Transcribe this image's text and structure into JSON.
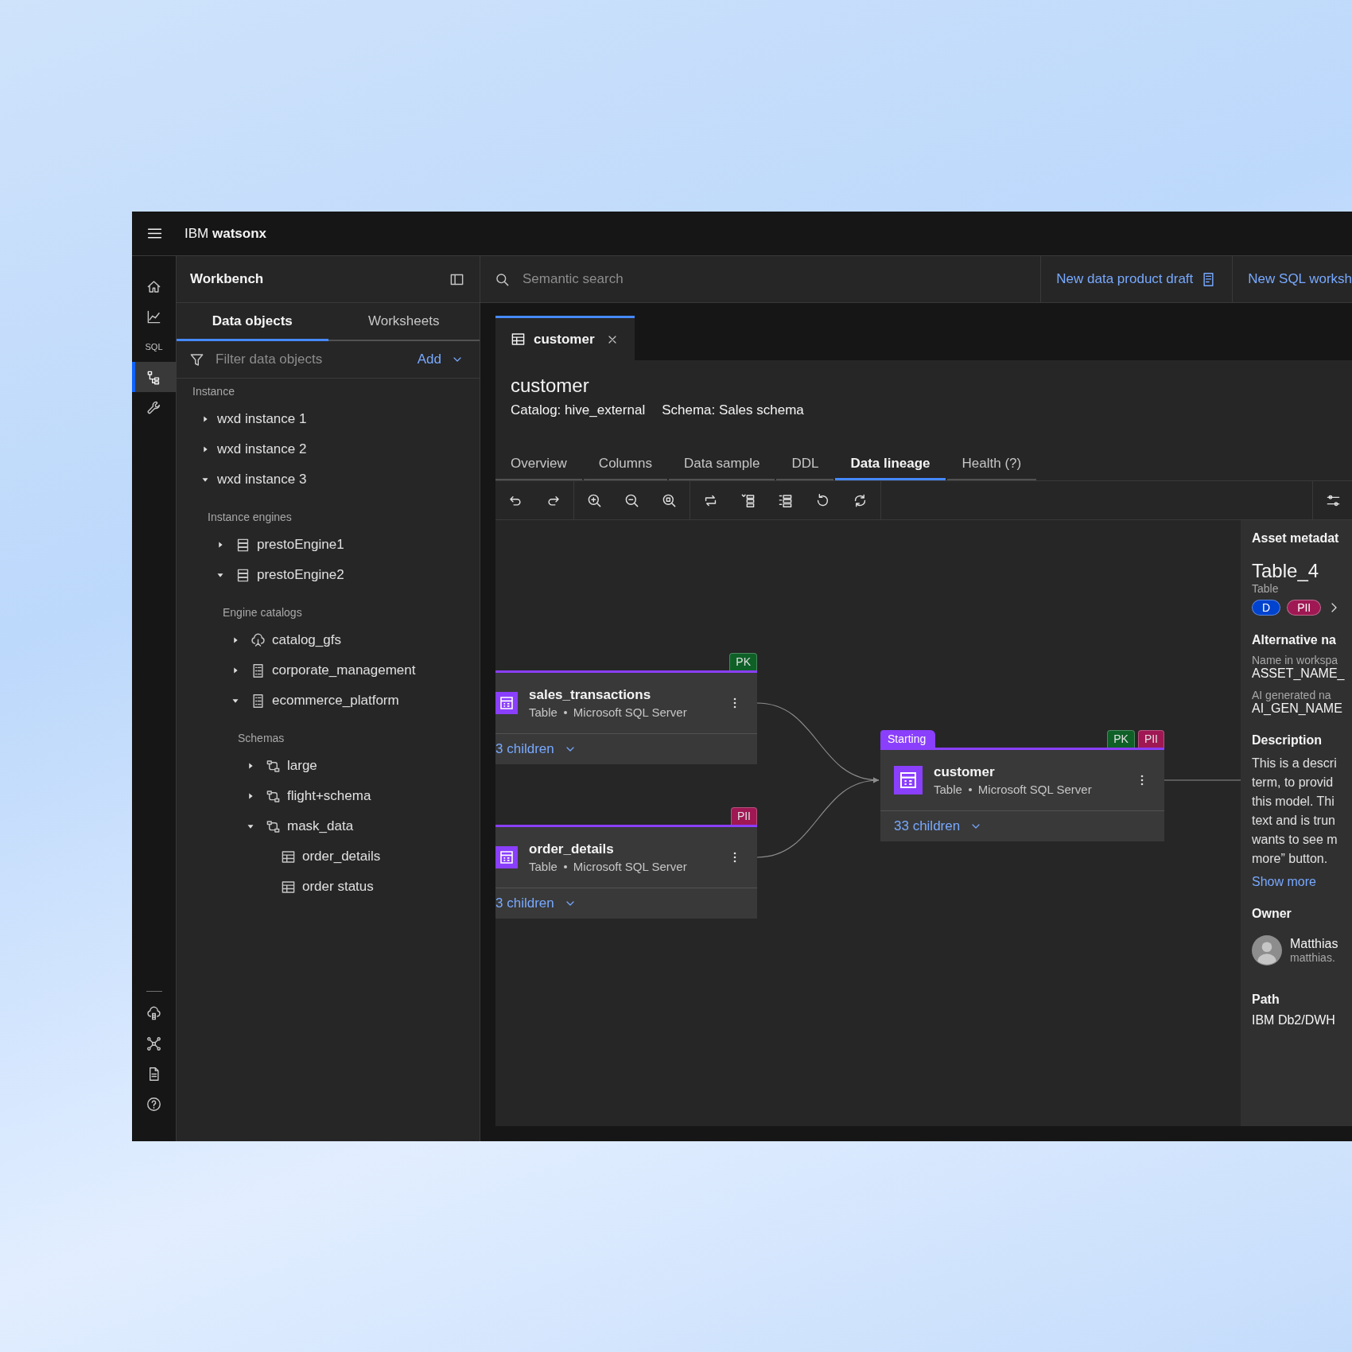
{
  "header": {
    "brand_prefix": "IBM",
    "brand_name": "watsonx"
  },
  "rail": {
    "top": [
      {
        "selected": false
      },
      {
        "selected": false
      },
      {
        "label": "SQL",
        "selected": false
      },
      {
        "selected": true
      },
      {
        "selected": false
      }
    ],
    "bottom": [
      {
        "selected": false
      },
      {
        "selected": false
      },
      {
        "selected": false
      },
      {
        "selected": false
      }
    ]
  },
  "side_panel": {
    "title": "Workbench",
    "tabs": [
      {
        "label": "Data objects",
        "selected": true
      },
      {
        "label": "Worksheets",
        "selected": false
      }
    ],
    "filter": {
      "placeholder": "Filter data objects"
    },
    "add_button": "Add",
    "tree": {
      "heading": "Instance",
      "items": [
        {
          "label": "wxd instance 1",
          "expanded": false
        },
        {
          "label": "wxd instance 2",
          "expanded": false
        },
        {
          "label": "wxd instance 3",
          "expanded": true,
          "group_label": "Instance engines",
          "children": [
            {
              "label": "prestoEngine1",
              "kind": "engine",
              "expanded": false
            },
            {
              "label": "prestoEngine2",
              "kind": "engine",
              "expanded": true,
              "group_label": "Engine catalogs",
              "children": [
                {
                  "label": "catalog_gfs",
                  "kind": "cloud-catalog",
                  "expanded": false
                },
                {
                  "label": "corporate_management",
                  "kind": "catalog",
                  "expanded": false
                },
                {
                  "label": "ecommerce_platform",
                  "kind": "catalog",
                  "expanded": true,
                  "group_label": "Schemas",
                  "children": [
                    {
                      "label": "large",
                      "kind": "schema",
                      "expanded": false
                    },
                    {
                      "label": "flight+schema",
                      "kind": "schema",
                      "expanded": false
                    },
                    {
                      "label": "mask_data",
                      "kind": "schema",
                      "expanded": true,
                      "children": [
                        {
                          "label": "order_details",
                          "kind": "table"
                        },
                        {
                          "label": "order status",
                          "kind": "table"
                        }
                      ]
                    }
                  ]
                }
              ]
            }
          ]
        }
      ]
    }
  },
  "top_bar": {
    "search": {
      "placeholder": "Semantic search"
    },
    "actions": [
      {
        "label": "New data product draft",
        "kind": "with-icon"
      },
      {
        "label": "New SQL worksh",
        "kind": "text"
      }
    ]
  },
  "document_tabs": [
    {
      "label": "customer",
      "selected": true
    }
  ],
  "asset": {
    "title": "customer",
    "catalog": "Catalog: hive_external",
    "schema": "Schema: Sales schema"
  },
  "detail_tabs": [
    {
      "label": "Overview",
      "selected": false
    },
    {
      "label": "Columns",
      "selected": false
    },
    {
      "label": "Data sample",
      "selected": false
    },
    {
      "label": "DDL",
      "selected": false
    },
    {
      "label": "Data lineage",
      "selected": true
    },
    {
      "label": "Health (?)",
      "selected": false
    }
  ],
  "lineage": {
    "nodes": [
      {
        "name": "sales_transactions",
        "type": "Table",
        "source": "Microsoft SQL Server",
        "children": "3 children",
        "tags": [
          {
            "label": "PK",
            "color": "#0e6027"
          }
        ]
      },
      {
        "name": "order_details",
        "type": "Table",
        "source": "Microsoft SQL Server",
        "children": "3 children",
        "tags": [
          {
            "label": "PII",
            "color": "#9f1853"
          }
        ]
      },
      {
        "name": "customer",
        "type": "Table",
        "source": "Microsoft SQL Server",
        "children": "33 children",
        "flag": "Starting",
        "tags": [
          {
            "label": "PK",
            "color": "#0e6027"
          },
          {
            "label": "PII",
            "color": "#9f1853"
          }
        ]
      }
    ]
  },
  "metadata": {
    "heading": "Asset metadat",
    "name": "Table_4",
    "type": "Table",
    "tags": [
      {
        "label": "D",
        "color": "#0043ce"
      },
      {
        "label": "PII",
        "color": "#9f1853"
      }
    ],
    "alt_heading": "Alternative na",
    "fields": [
      {
        "label": "Name in workspa",
        "value": "ASSET_NAME_"
      },
      {
        "label": "AI generated na",
        "value": "AI_GEN_NAME"
      }
    ],
    "description_heading": "Description",
    "description_lines": [
      "This is a descri",
      "term, to provid",
      "this model. Thi",
      "text and is trun",
      "wants to see m",
      "more” button."
    ],
    "show_more": "Show more",
    "owner_heading": "Owner",
    "owner": {
      "name": "Matthias",
      "email": "matthias."
    },
    "path_heading": "Path",
    "path": "IBM Db2/DWH"
  }
}
